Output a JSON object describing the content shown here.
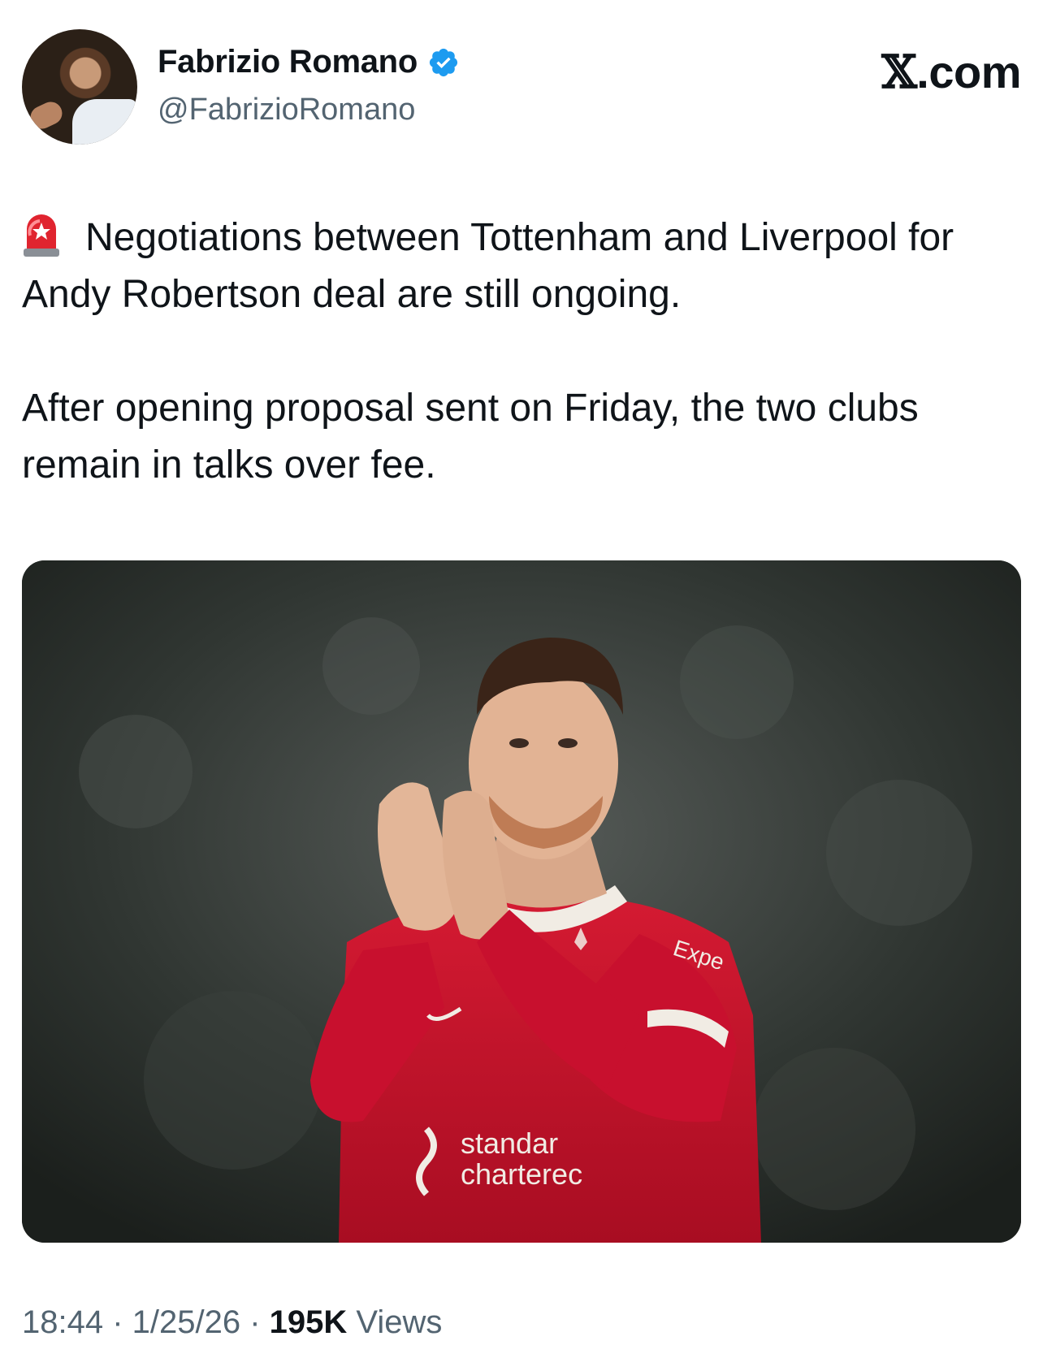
{
  "profile": {
    "name": "Fabrizio Romano",
    "handle": "@FabrizioRomano",
    "verified": true,
    "avatar_icon": "profile-photo-icon"
  },
  "brand": {
    "label_x": "𝕏",
    "label_rest": ".com"
  },
  "tweet": {
    "alert_icon": "rotating-light-icon",
    "line1": "Negotiations between Tottenham and Liverpool for Andy Robertson deal are still ongoing.",
    "line2": "After opening proposal sent on Friday, the two clubs remain in talks over fee."
  },
  "media": {
    "shirt_text_1": "standar",
    "shirt_text_2": "charterec",
    "sleeve_text": "Expe"
  },
  "meta": {
    "time": "18:44",
    "sep1": " · ",
    "date": "1/25/26",
    "sep2": " · ",
    "views_count": "195K",
    "views_label": " Views"
  },
  "colors": {
    "verified": "#1d9bf0",
    "secondary_text": "#536471",
    "jersey": "#c8102e"
  }
}
